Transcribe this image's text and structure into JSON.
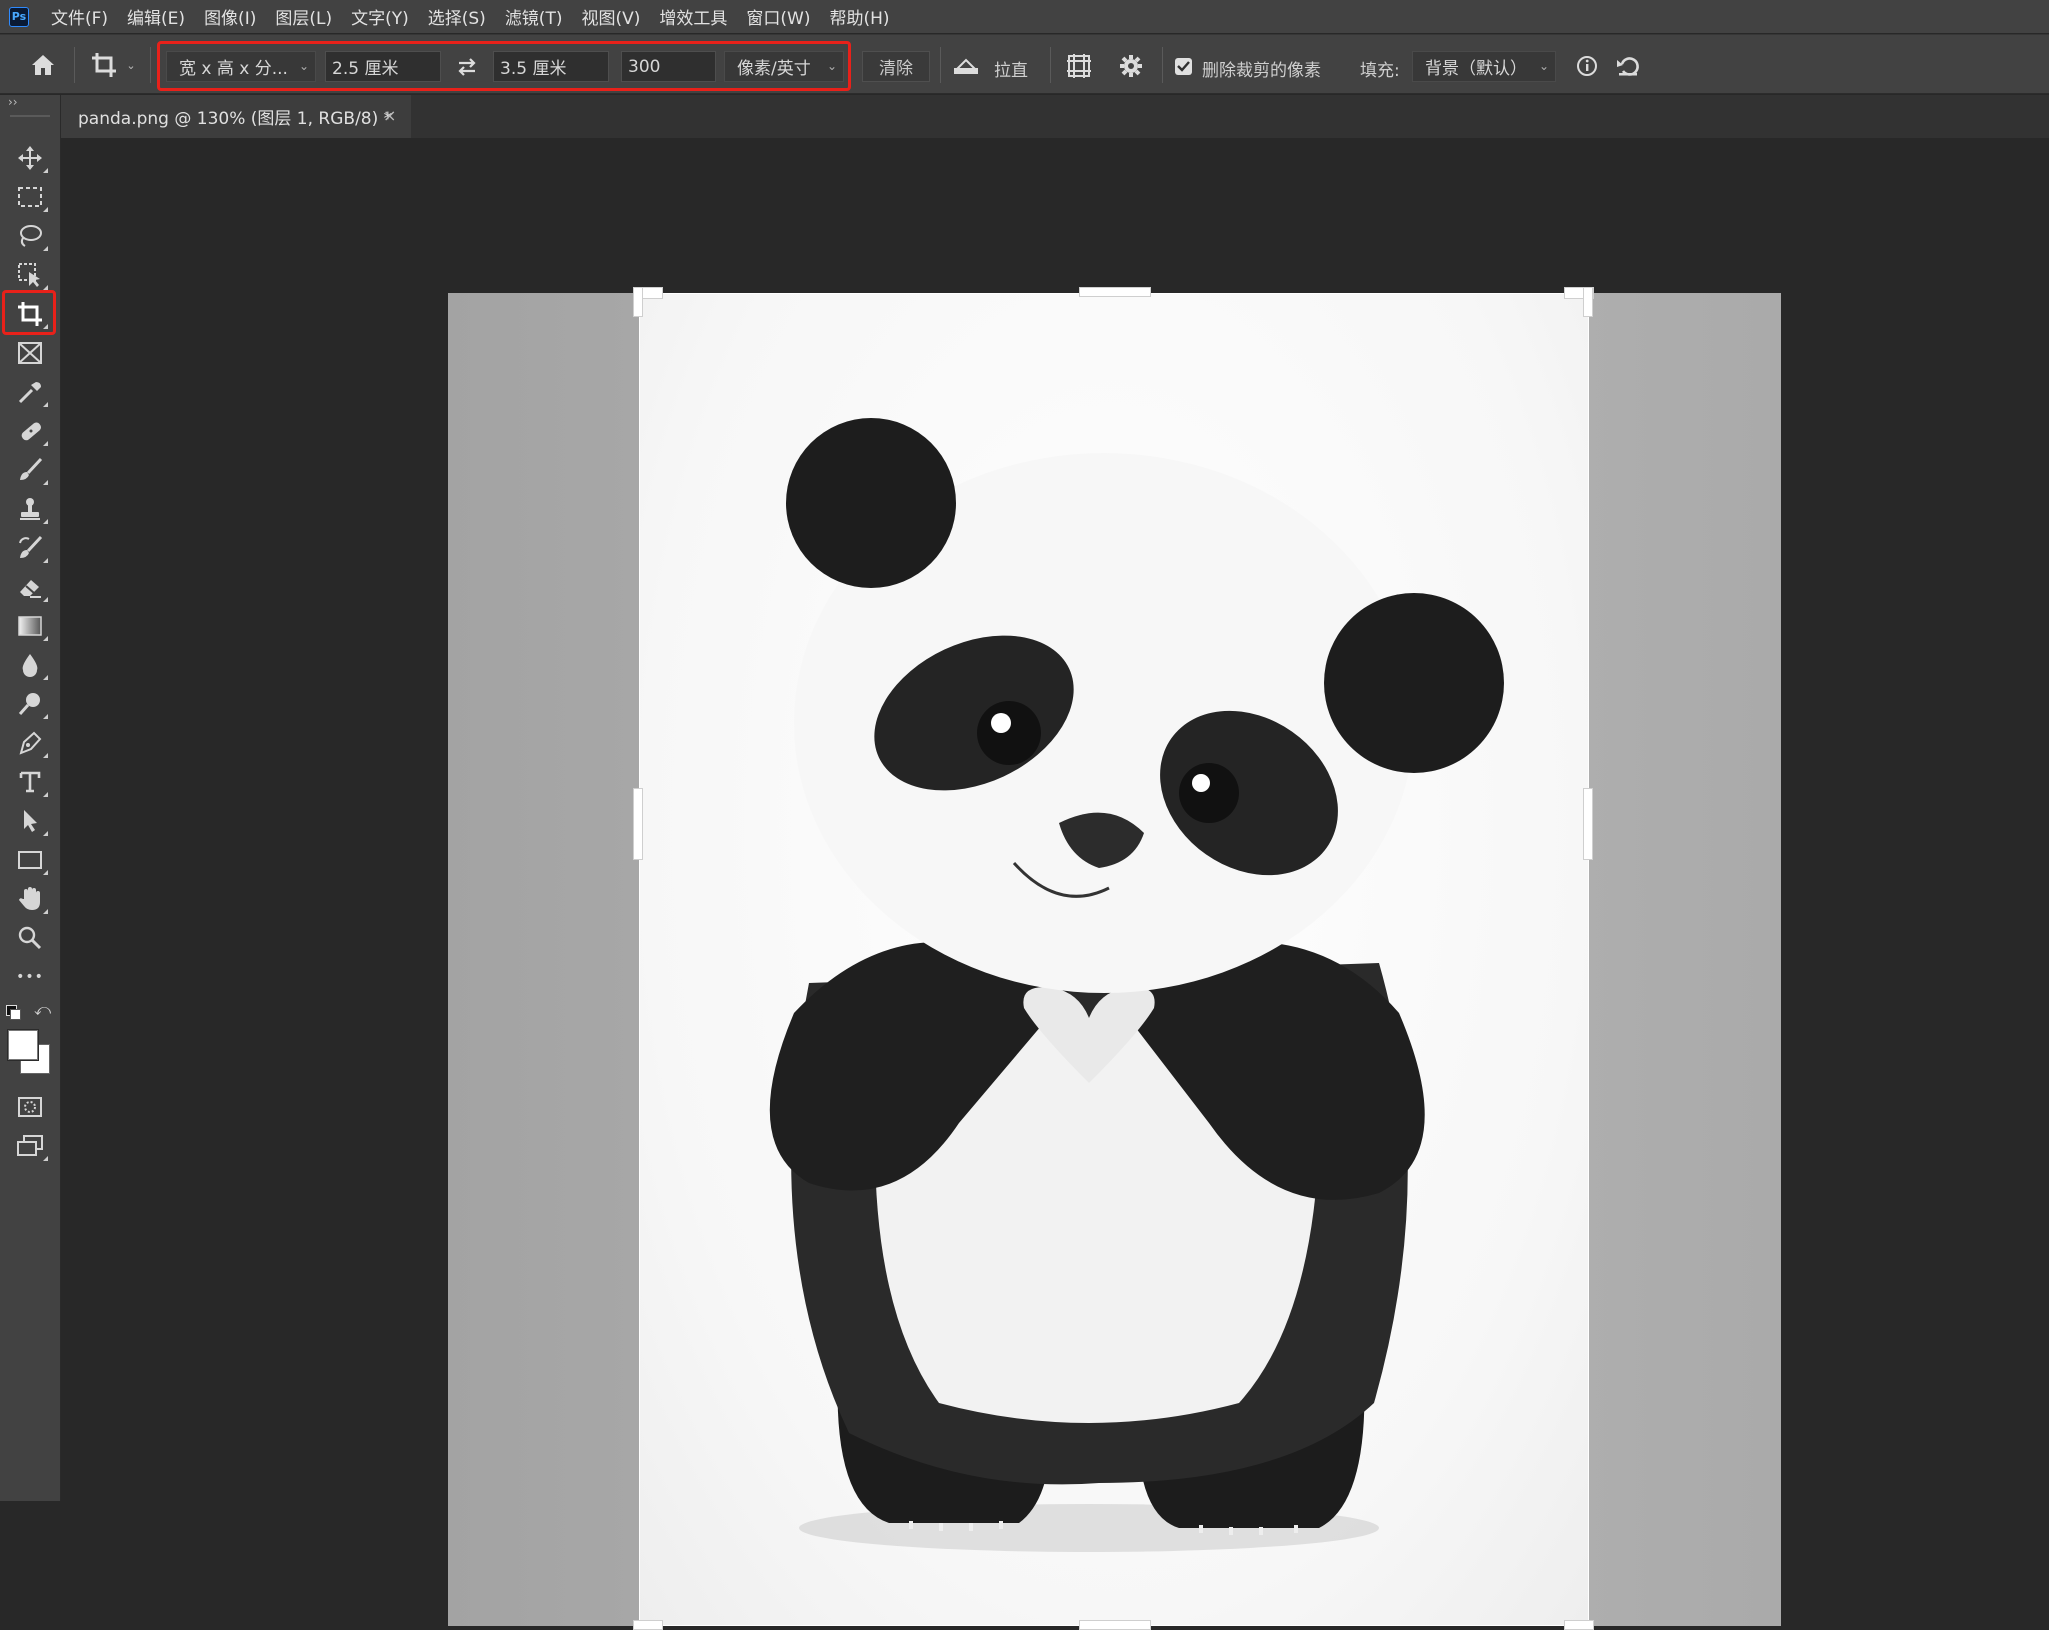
{
  "app": {
    "logo": "Ps"
  },
  "menu": [
    "文件(F)",
    "编辑(E)",
    "图像(I)",
    "图层(L)",
    "文字(Y)",
    "选择(S)",
    "滤镜(T)",
    "视图(V)",
    "增效工具",
    "窗口(W)",
    "帮助(H)"
  ],
  "options": {
    "ratio_preset": "宽 x 高 x 分...",
    "width": "2.5 厘米",
    "height": "3.5 厘米",
    "resolution": "300",
    "resolution_unit": "像素/英寸",
    "clear_label": "清除",
    "straighten_label": "拉直",
    "delete_cropped_label": "删除裁剪的像素",
    "delete_cropped_checked": true,
    "fill_label": "填充:",
    "fill_value": "背景（默认）"
  },
  "document": {
    "tab_title": "panda.png @ 130% (图层 1, RGB/8) *",
    "close_glyph": "×"
  },
  "toolbar": {
    "collapse_glyph": "››",
    "active_tool": "crop-tool",
    "more_glyph": "•••"
  },
  "icons": [
    "home-icon",
    "crop-tool-icon",
    "swap-icon",
    "straighten-icon",
    "grid-overlay-icon",
    "settings-icon",
    "info-icon",
    "reset-icon"
  ],
  "colors": {
    "highlight": "#e8211a",
    "panel": "#424242",
    "canvas_bg": "#282828"
  }
}
